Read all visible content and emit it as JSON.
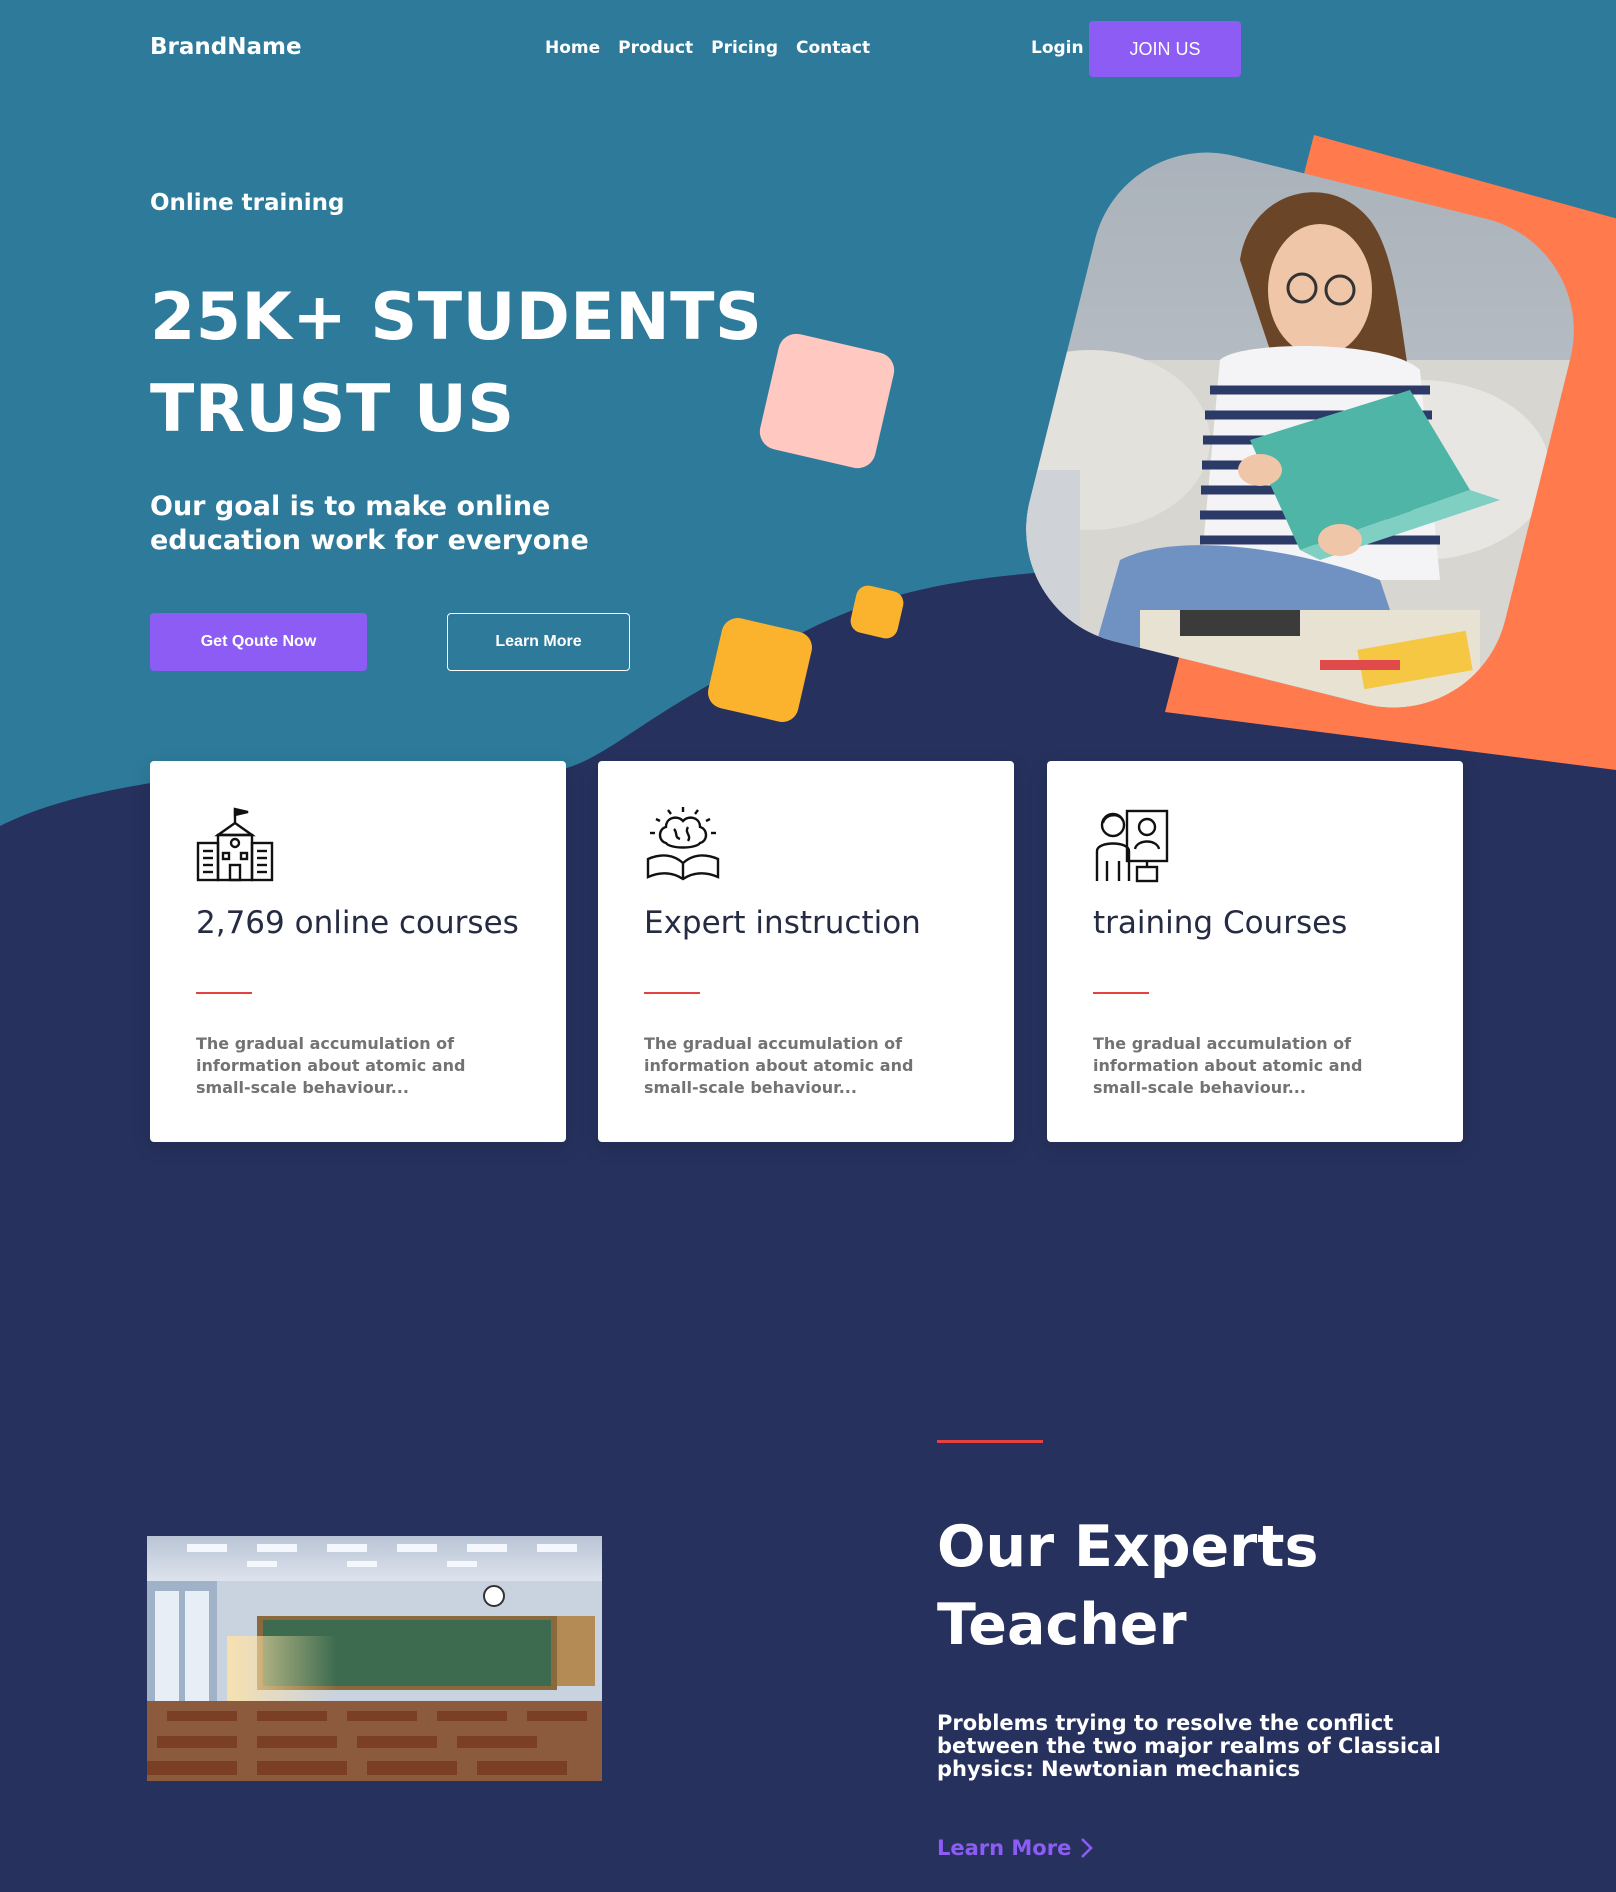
{
  "colors": {
    "hero_bg": "#2e7a9a",
    "dark_bg": "#26315d",
    "accent_purple": "#8c5cf4",
    "orange": "#ff7b4e",
    "yellow": "#fbb32e",
    "pink": "#ffc8c0",
    "red_rule": "#e74040"
  },
  "header": {
    "brand": "BrandName",
    "nav": [
      "Home",
      "Product",
      "Pricing",
      "Contact"
    ],
    "login": "Login",
    "join": "JOIN US"
  },
  "hero": {
    "eyebrow": "Online training",
    "headline_line1": "25K+ STUDENTS",
    "headline_line2": "TRUST US",
    "subline": "Our goal is to make online education work for everyone",
    "primary_button": "Get Qoute Now",
    "secondary_button": "Learn More",
    "photo_icon": "student-reading-photo"
  },
  "features": [
    {
      "icon": "school-building-icon",
      "title": "2,769 online courses",
      "desc": "The gradual accumulation of information about atomic and small-scale behaviour..."
    },
    {
      "icon": "brain-book-icon",
      "title": "Expert instruction",
      "desc": "The gradual accumulation of information about atomic and small-scale behaviour..."
    },
    {
      "icon": "teacher-screen-icon",
      "title": "training Courses",
      "desc": "The gradual accumulation of information about atomic and small-scale behaviour..."
    }
  ],
  "experts": {
    "title_line1": "Our Experts",
    "title_line2": "Teacher",
    "desc": "Problems trying to resolve the conflict between the two major realms of Classical physics: Newtonian mechanics",
    "link": "Learn More",
    "image_icon": "classroom-photo"
  }
}
